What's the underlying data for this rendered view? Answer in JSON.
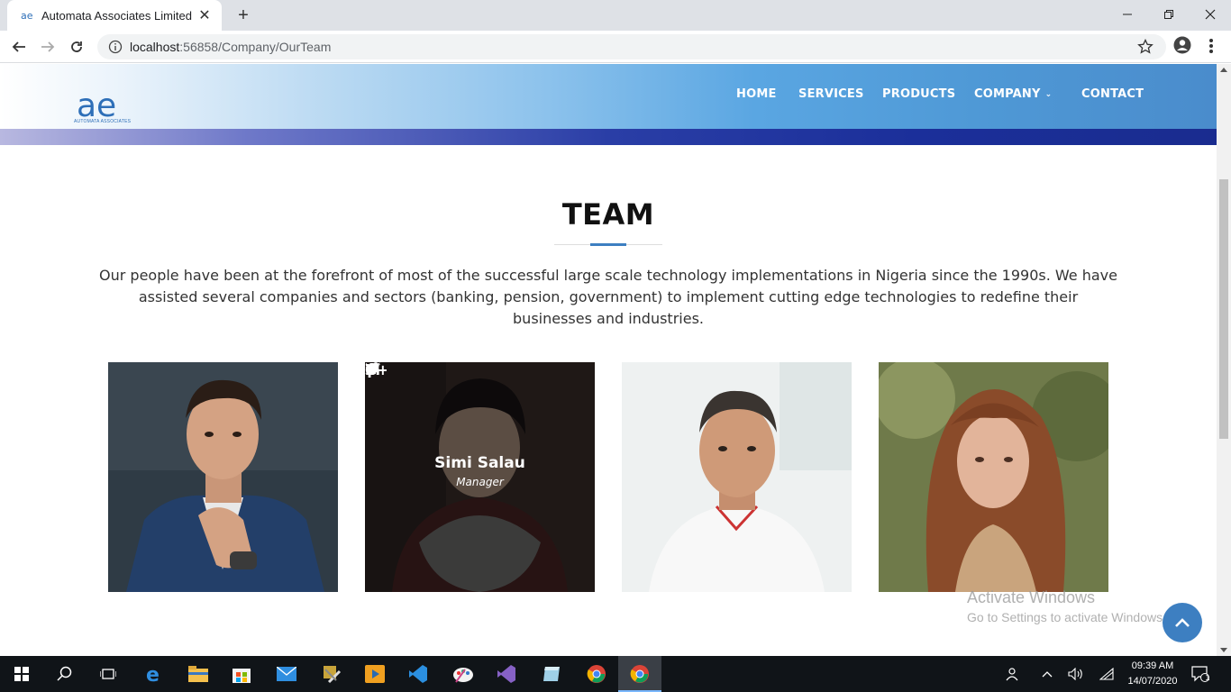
{
  "browser": {
    "tab_title": "Automata Associates Limited",
    "url_host": "localhost",
    "url_path": ":56858/Company/OurTeam",
    "new_tab_symbol": "+",
    "close_tab_symbol": "✕"
  },
  "site": {
    "logo_caption": "AUTOMATA ASSOCIATES",
    "nav": {
      "home": "HOME",
      "services": "SERVICES",
      "products": "PRODUCTS",
      "company": "COMPANY",
      "contact": "CONTACT"
    }
  },
  "team": {
    "title": "TEAM",
    "intro": "Our people have been at the forefront of most of the successful large scale technology implementations in Nigeria since the 1990s. We have assisted several companies and sectors (banking, pension, government) to implement cutting edge technologies to redefine their businesses and industries.",
    "members": [
      {
        "name": "",
        "role": ""
      },
      {
        "name": "Simi Salau",
        "role": "Manager"
      },
      {
        "name": "",
        "role": ""
      },
      {
        "name": "",
        "role": ""
      }
    ],
    "social_icons": [
      "twitter-icon",
      "facebook-icon",
      "google-plus-icon",
      "linkedin-icon"
    ]
  },
  "watermark": {
    "line1": "Activate Windows",
    "line2": "Go to Settings to activate Windows."
  },
  "taskbar": {
    "time": "09:39 AM",
    "date": "14/07/2020",
    "notification_count": "1"
  },
  "colors": {
    "accent": "#3d7fc1",
    "header_dark": "#1a2c8f",
    "chrome_bg": "#dee1e6"
  }
}
